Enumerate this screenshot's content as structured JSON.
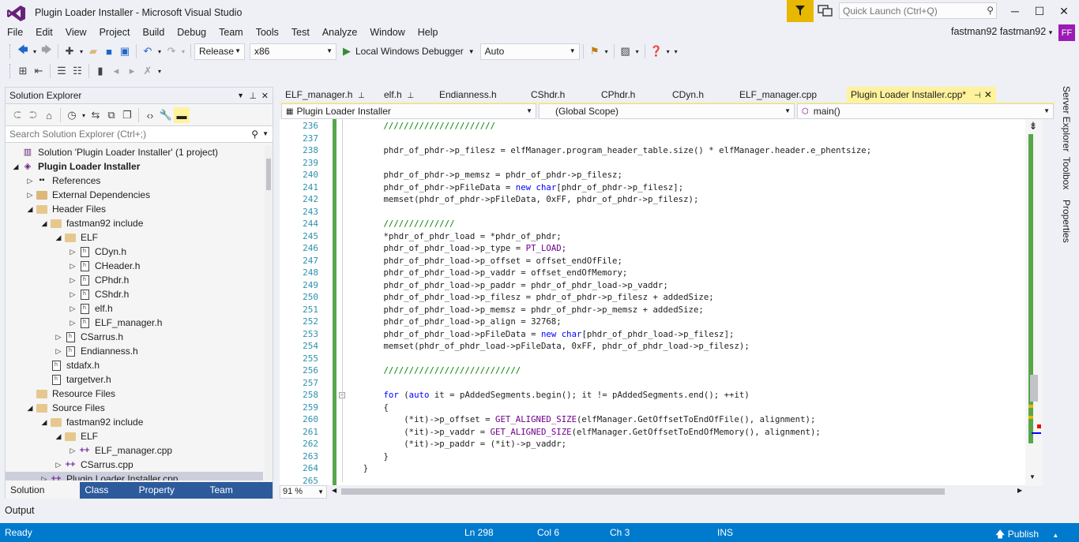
{
  "window": {
    "title": "Plugin Loader Installer - Microsoft Visual Studio",
    "quick_launch_placeholder": "Quick Launch (Ctrl+Q)",
    "user_name": "fastman92 fastman92",
    "user_initials": "FF",
    "controls": {
      "minimize": "─",
      "maximize": "☐",
      "close": "✕"
    }
  },
  "menu": [
    "File",
    "Edit",
    "View",
    "Project",
    "Build",
    "Debug",
    "Team",
    "Tools",
    "Test",
    "Analyze",
    "Window",
    "Help"
  ],
  "toolbar": {
    "configuration": "Release",
    "platform": "x86",
    "debugger": "Local Windows Debugger",
    "debug_mode": "Auto"
  },
  "solution_explorer": {
    "title": "Solution Explorer",
    "search_placeholder": "Search Solution Explorer (Ctrl+;)",
    "tree": [
      {
        "label": "Solution 'Plugin Loader Installer' (1 project)",
        "level": 0,
        "expander": "",
        "icon": "solution"
      },
      {
        "label": "Plugin Loader Installer",
        "level": 0,
        "expander": "◢",
        "icon": "project",
        "bold": true
      },
      {
        "label": "References",
        "level": 1,
        "expander": "▷",
        "icon": "references"
      },
      {
        "label": "External Dependencies",
        "level": 1,
        "expander": "▷",
        "icon": "folder"
      },
      {
        "label": "Header Files",
        "level": 1,
        "expander": "◢",
        "icon": "filter"
      },
      {
        "label": "fastman92 include",
        "level": 2,
        "expander": "◢",
        "icon": "filter"
      },
      {
        "label": "ELF",
        "level": 3,
        "expander": "◢",
        "icon": "filter"
      },
      {
        "label": "CDyn.h",
        "level": 4,
        "expander": "▷",
        "icon": "header"
      },
      {
        "label": "CHeader.h",
        "level": 4,
        "expander": "▷",
        "icon": "header"
      },
      {
        "label": "CPhdr.h",
        "level": 4,
        "expander": "▷",
        "icon": "header"
      },
      {
        "label": "CShdr.h",
        "level": 4,
        "expander": "▷",
        "icon": "header"
      },
      {
        "label": "elf.h",
        "level": 4,
        "expander": "▷",
        "icon": "header"
      },
      {
        "label": "ELF_manager.h",
        "level": 4,
        "expander": "▷",
        "icon": "header"
      },
      {
        "label": "CSarrus.h",
        "level": 3,
        "expander": "▷",
        "icon": "header"
      },
      {
        "label": "Endianness.h",
        "level": 3,
        "expander": "▷",
        "icon": "header"
      },
      {
        "label": "stdafx.h",
        "level": 2,
        "expander": "",
        "icon": "header"
      },
      {
        "label": "targetver.h",
        "level": 2,
        "expander": "",
        "icon": "header"
      },
      {
        "label": "Resource Files",
        "level": 1,
        "expander": "",
        "icon": "filter"
      },
      {
        "label": "Source Files",
        "level": 1,
        "expander": "◢",
        "icon": "filter"
      },
      {
        "label": "fastman92 include",
        "level": 2,
        "expander": "◢",
        "icon": "filter"
      },
      {
        "label": "ELF",
        "level": 3,
        "expander": "◢",
        "icon": "filter"
      },
      {
        "label": "ELF_manager.cpp",
        "level": 4,
        "expander": "▷",
        "icon": "cpp"
      },
      {
        "label": "CSarrus.cpp",
        "level": 3,
        "expander": "▷",
        "icon": "cpp"
      },
      {
        "label": "Plugin Loader Installer.cpp",
        "level": 2,
        "expander": "▷",
        "icon": "cpp",
        "selected": true
      }
    ],
    "bottom_tabs": [
      "Solution Explo...",
      "Class View",
      "Property Man...",
      "Team Explorer"
    ]
  },
  "side_panels": [
    "Server Explorer",
    "Toolbox",
    "Properties"
  ],
  "editor": {
    "tabs": [
      {
        "label": "ELF_manager.h",
        "pinned": true
      },
      {
        "label": "elf.h",
        "pinned": true
      },
      {
        "label": "Endianness.h"
      },
      {
        "label": "CShdr.h"
      },
      {
        "label": "CPhdr.h"
      },
      {
        "label": "CDyn.h"
      },
      {
        "label": "ELF_manager.cpp"
      },
      {
        "label": "Plugin Loader Installer.cpp*",
        "active": true
      }
    ],
    "nav_project": "Plugin Loader Installer",
    "nav_scope": "(Global Scope)",
    "nav_member": "main()",
    "zoom": "91 %",
    "lines": [
      {
        "n": "236",
        "code": "        //////////////////////"
      },
      {
        "n": "237",
        "code": ""
      },
      {
        "n": "238",
        "code": "        phdr_of_phdr->p_filesz = elfManager.program_header_table.size() * elfManager.header.e_phentsize;"
      },
      {
        "n": "239",
        "code": ""
      },
      {
        "n": "240",
        "code": "        phdr_of_phdr->p_memsz = phdr_of_phdr->p_filesz;"
      },
      {
        "n": "241",
        "code": "        phdr_of_phdr->pFileData = new char[phdr_of_phdr->p_filesz];"
      },
      {
        "n": "242",
        "code": "        memset(phdr_of_phdr->pFileData, 0xFF, phdr_of_phdr->p_filesz);"
      },
      {
        "n": "243",
        "code": ""
      },
      {
        "n": "244",
        "code": "        //////////////"
      },
      {
        "n": "245",
        "code": "        *phdr_of_phdr_load = *phdr_of_phdr;"
      },
      {
        "n": "246",
        "code": "        phdr_of_phdr_load->p_type = PT_LOAD;"
      },
      {
        "n": "247",
        "code": "        phdr_of_phdr_load->p_offset = offset_endOfFile;"
      },
      {
        "n": "248",
        "code": "        phdr_of_phdr_load->p_vaddr = offset_endOfMemory;"
      },
      {
        "n": "249",
        "code": "        phdr_of_phdr_load->p_paddr = phdr_of_phdr_load->p_vaddr;"
      },
      {
        "n": "250",
        "code": "        phdr_of_phdr_load->p_filesz = phdr_of_phdr->p_filesz + addedSize;"
      },
      {
        "n": "251",
        "code": "        phdr_of_phdr_load->p_memsz = phdr_of_phdr->p_memsz + addedSize;"
      },
      {
        "n": "252",
        "code": "        phdr_of_phdr_load->p_align = 32768;"
      },
      {
        "n": "253",
        "code": "        phdr_of_phdr_load->pFileData = new char[phdr_of_phdr_load->p_filesz];"
      },
      {
        "n": "254",
        "code": "        memset(phdr_of_phdr_load->pFileData, 0xFF, phdr_of_phdr_load->p_filesz);"
      },
      {
        "n": "255",
        "code": ""
      },
      {
        "n": "256",
        "code": "        ///////////////////////////"
      },
      {
        "n": "257",
        "code": ""
      },
      {
        "n": "258",
        "code": "        for (auto it = pAddedSegments.begin(); it != pAddedSegments.end(); ++it)"
      },
      {
        "n": "259",
        "code": "        {"
      },
      {
        "n": "260",
        "code": "            (*it)->p_offset = GET_ALIGNED_SIZE(elfManager.GetOffsetToEndOfFile(), alignment);"
      },
      {
        "n": "261",
        "code": "            (*it)->p_vaddr = GET_ALIGNED_SIZE(elfManager.GetOffsetToEndOfMemory(), alignment);"
      },
      {
        "n": "262",
        "code": "            (*it)->p_paddr = (*it)->p_vaddr;"
      },
      {
        "n": "263",
        "code": "        }"
      },
      {
        "n": "264",
        "code": "    }"
      },
      {
        "n": "265",
        "code": ""
      }
    ]
  },
  "output_label": "Output",
  "status": {
    "ready": "Ready",
    "ln": "Ln 298",
    "col": "Col 6",
    "ch": "Ch 3",
    "ins": "INS",
    "publish": "Publish"
  },
  "colors": {
    "accent": "#007acc",
    "active_tab": "#fff29d",
    "line_number": "#2b91af",
    "keyword": "#0000ff",
    "macro": "#6f008a",
    "comment": "#008000",
    "avatar": "#9b1cb4",
    "notification": "#e8b700"
  }
}
